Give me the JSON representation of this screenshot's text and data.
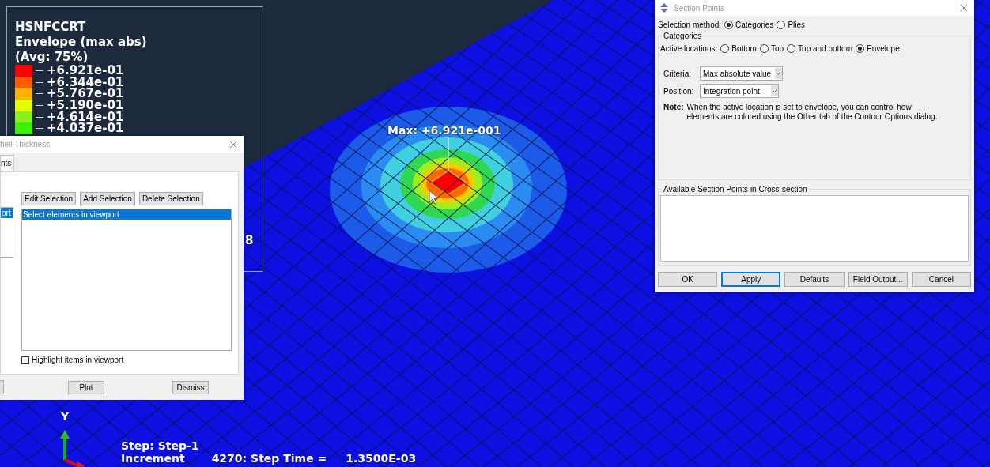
{
  "viewport": {
    "legend": {
      "title_lines": [
        "HSNFCCRT",
        "Envelope (max abs)",
        "(Avg: 75%)"
      ],
      "entries": [
        {
          "label": "+6.921e-01",
          "color": "#ff0000"
        },
        {
          "label": "+6.344e-01",
          "color": "#ff5a00"
        },
        {
          "label": "+5.767e-01",
          "color": "#ffb400"
        },
        {
          "label": "+5.190e-01",
          "color": "#e6ff00"
        },
        {
          "label": "+4.614e-01",
          "color": "#8cf020"
        },
        {
          "label": "+4.037e-01",
          "color": "#3cf000"
        }
      ],
      "partial_text": "8"
    },
    "max_label": "Max: +6.921e-001",
    "triad": {
      "axis_label": "Y"
    },
    "status_lines": [
      [
        "Step: Step-1"
      ],
      [
        "Increment",
        "4270: Step Time =",
        "1.3500E-03"
      ]
    ]
  },
  "shell_dialog": {
    "title": "hell Thickness",
    "tab": {
      "label": "nts",
      "selected": true
    },
    "left_list": [
      {
        "label": "ort",
        "selected": true
      }
    ],
    "selection_buttons": [
      "Edit Selection",
      "Add Selection",
      "Delete Selection"
    ],
    "list_items": [
      {
        "label": "Select elements in viewport",
        "selected": true
      }
    ],
    "highlight_checkbox": {
      "label": "Highlight items in viewport",
      "checked": false
    },
    "buttons": [
      "Plot",
      "Dismiss"
    ]
  },
  "section_dialog": {
    "title": "Section Points",
    "selection_method": {
      "label": "Selection method:",
      "options": [
        {
          "label": "Categories",
          "selected": true
        },
        {
          "label": "Plies",
          "selected": false
        }
      ]
    },
    "categories": {
      "title": "Categories",
      "active_locations": {
        "label": "Active locations:",
        "options": [
          {
            "label": "Bottom",
            "selected": false
          },
          {
            "label": "Top",
            "selected": false
          },
          {
            "label": "Top and bottom",
            "selected": false
          },
          {
            "label": "Envelope",
            "selected": true
          }
        ]
      },
      "criteria": {
        "label": "Criteria:",
        "value": "Max absolute value"
      },
      "position": {
        "label": "Position:",
        "value": "Integration point"
      },
      "note": {
        "label": "Note:",
        "text": "When the active location is set to envelope, you can control how elements are colored using the Other tab of the Contour Options dialog."
      }
    },
    "available": {
      "title": "Available Section Points in Cross-section"
    },
    "buttons": [
      {
        "label": "OK",
        "focused": false
      },
      {
        "label": "Apply",
        "focused": true
      },
      {
        "label": "Defaults",
        "focused": false
      },
      {
        "label": "Field Output...",
        "focused": false
      },
      {
        "label": "Cancel",
        "focused": false
      }
    ]
  }
}
